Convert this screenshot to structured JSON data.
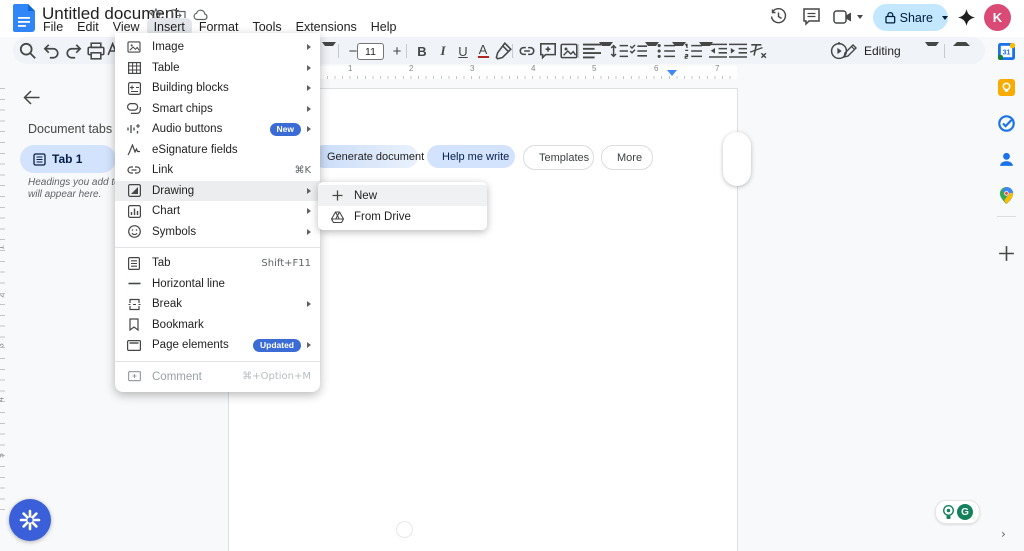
{
  "header": {
    "title": "Untitled document",
    "menu_items": [
      "File",
      "Edit",
      "View",
      "Insert",
      "Format",
      "Tools",
      "Extensions",
      "Help"
    ],
    "share_label": "Share",
    "avatar_initial": "K"
  },
  "toolbar": {
    "font_size": "11",
    "bold": "B",
    "italic": "I",
    "underline": "U",
    "text_color": "A",
    "minus": "−",
    "plus": "+",
    "mode_label": "Editing"
  },
  "sidebar": {
    "heading": "Document tabs",
    "tab_label": "Tab 1",
    "hint_line1": "Headings you add to the",
    "hint_line2": "will appear here."
  },
  "ruler": {
    "h_numbers": [
      "1",
      "2",
      "3",
      "4",
      "5",
      "6",
      "7"
    ],
    "v_numbers": [
      "1",
      "2",
      "3",
      "4",
      "5"
    ]
  },
  "page": {
    "chips": [
      {
        "label": "Generate document"
      },
      {
        "label": "Help me write"
      },
      {
        "label": "Templates"
      },
      {
        "label": "More"
      }
    ]
  },
  "insert_menu": {
    "items": [
      {
        "label": "Image"
      },
      {
        "label": "Table"
      },
      {
        "label": "Building blocks"
      },
      {
        "label": "Smart chips"
      },
      {
        "label": "Audio buttons",
        "badge": "New"
      },
      {
        "label": "eSignature fields"
      },
      {
        "label": "Link",
        "shortcut": "⌘K"
      },
      {
        "label": "Drawing"
      },
      {
        "label": "Chart"
      },
      {
        "label": "Symbols"
      },
      {
        "label": "Tab",
        "shortcut": "Shift+F11"
      },
      {
        "label": "Horizontal line"
      },
      {
        "label": "Break"
      },
      {
        "label": "Bookmark"
      },
      {
        "label": "Page elements",
        "badge": "Updated"
      },
      {
        "label": "Comment",
        "shortcut": "⌘+Option+M"
      }
    ]
  },
  "drawing_submenu": {
    "items": [
      {
        "label": "New"
      },
      {
        "label": "From Drive"
      }
    ]
  },
  "side_panel": {
    "calendar_day": "31",
    "grammarly_letter": "G",
    "expand_arrow": "›"
  },
  "colors": {
    "accent_blue": "#0b57d0",
    "badge_blue": "#3b6cd6",
    "share_pill": "#c2e7ff",
    "tab_pill": "#d3e3fd",
    "avatar": "#d94a77",
    "fab_blue": "#3a5fd8",
    "grammarly_green": "#15815b"
  }
}
